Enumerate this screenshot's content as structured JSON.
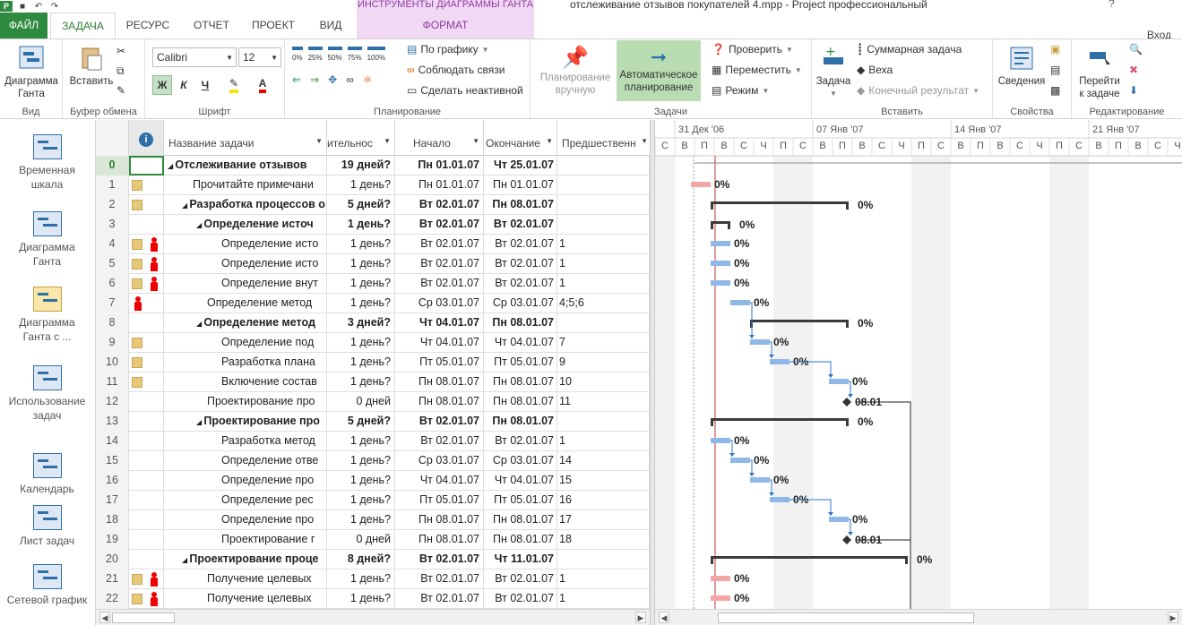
{
  "window": {
    "title": "отслеживание отзывов покупателей 4.mpp - Project профессиональный",
    "context_tab_group": "ИНСТРУМЕНТЫ ДИАГРАММЫ ГАНТА",
    "help": "?",
    "signin": "Вход"
  },
  "tabs": [
    {
      "label": "ФАЙЛ"
    },
    {
      "label": "ЗАДАЧА"
    },
    {
      "label": "РЕСУРС"
    },
    {
      "label": "ОТЧЕТ"
    },
    {
      "label": "ПРОЕКТ"
    },
    {
      "label": "ВИД"
    },
    {
      "label": "ФОРМАТ"
    }
  ],
  "ribbon": {
    "view": {
      "group": "Вид",
      "gantt_btn_line1": "Диаграмма",
      "gantt_btn_line2": "Ганта"
    },
    "clipboard": {
      "group": "Буфер обмена",
      "paste": "Вставить"
    },
    "font": {
      "group": "Шрифт",
      "family": "Calibri",
      "size": "12",
      "bold": "Ж",
      "italic": "К",
      "underline": "Ч"
    },
    "schedule": {
      "group": "Планирование",
      "pcts": [
        "0%",
        "25%",
        "50%",
        "75%",
        "100%"
      ],
      "by_schedule": "По графику",
      "respect_links": "Соблюдать связи",
      "inactivate": "Сделать неактивной"
    },
    "tasks": {
      "group": "Задачи",
      "manual_line1": "Планирование",
      "manual_line2": "вручную",
      "auto_line1": "Автоматическое",
      "auto_line2": "планирование",
      "inspect": "Проверить",
      "move": "Переместить",
      "mode": "Режим"
    },
    "insert": {
      "group": "Вставить",
      "task": "Задача",
      "summary": "Суммарная задача",
      "milestone": "Веха",
      "deliverable": "Конечный результат"
    },
    "properties": {
      "group": "Свойства",
      "info": "Сведения"
    },
    "editing": {
      "group": "Редактирование",
      "goto_line1": "Перейти",
      "goto_line2": "к задаче"
    }
  },
  "viewbar": [
    {
      "line1": "Временная",
      "line2": "шкала"
    },
    {
      "line1": "Диаграмма",
      "line2": "Ганта"
    },
    {
      "line1": "Диаграмма",
      "line2": "Ганта с ...",
      "selected": true
    },
    {
      "line1": "Использование",
      "line2": "задач"
    },
    {
      "line1": "Календарь",
      "line2": ""
    },
    {
      "line1": "Лист задач",
      "line2": ""
    },
    {
      "line1": "Сетевой график",
      "line2": ""
    }
  ],
  "columns": {
    "info": "i",
    "name": "Название задачи",
    "duration": "ительнос",
    "start": "Начало",
    "finish": "Окончание",
    "predecessors": "Предшественн"
  },
  "rows": [
    {
      "id": "0",
      "name": "Отслеживание отзывов",
      "dur": "19 дней?",
      "start": "Пн 01.01.07",
      "finish": "Чт 25.01.07",
      "pred": "",
      "bold": true,
      "level": 0,
      "summary": true,
      "note": false,
      "person": false
    },
    {
      "id": "1",
      "name": "Прочитайте примечани",
      "dur": "1 день?",
      "start": "Пн 01.01.07",
      "finish": "Пн 01.01.07",
      "pred": "",
      "bold": false,
      "level": 1,
      "summary": false,
      "note": true,
      "person": false
    },
    {
      "id": "2",
      "name": "Разработка процессов о",
      "dur": "5 дней?",
      "start": "Вт 02.01.07",
      "finish": "Пн 08.01.07",
      "pred": "",
      "bold": true,
      "level": 1,
      "summary": true,
      "note": true,
      "person": false
    },
    {
      "id": "3",
      "name": "Определение источ",
      "dur": "1 день?",
      "start": "Вт 02.01.07",
      "finish": "Вт 02.01.07",
      "pred": "",
      "bold": true,
      "level": 2,
      "summary": true,
      "note": false,
      "person": false
    },
    {
      "id": "4",
      "name": "Определение исто",
      "dur": "1 день?",
      "start": "Вт 02.01.07",
      "finish": "Вт 02.01.07",
      "pred": "1",
      "bold": false,
      "level": 3,
      "summary": false,
      "note": true,
      "person": true
    },
    {
      "id": "5",
      "name": "Определение исто",
      "dur": "1 день?",
      "start": "Вт 02.01.07",
      "finish": "Вт 02.01.07",
      "pred": "1",
      "bold": false,
      "level": 3,
      "summary": false,
      "note": true,
      "person": true
    },
    {
      "id": "6",
      "name": "Определение внут",
      "dur": "1 день?",
      "start": "Вт 02.01.07",
      "finish": "Вт 02.01.07",
      "pred": "1",
      "bold": false,
      "level": 3,
      "summary": false,
      "note": true,
      "person": true
    },
    {
      "id": "7",
      "name": "Определение метод",
      "dur": "1 день?",
      "start": "Ср 03.01.07",
      "finish": "Ср 03.01.07",
      "pred": "4;5;6",
      "bold": false,
      "level": 2,
      "summary": false,
      "note": false,
      "person": true
    },
    {
      "id": "8",
      "name": "Определение метод",
      "dur": "3 дней?",
      "start": "Чт 04.01.07",
      "finish": "Пн 08.01.07",
      "pred": "",
      "bold": true,
      "level": 2,
      "summary": true,
      "note": false,
      "person": false
    },
    {
      "id": "9",
      "name": "Определение под",
      "dur": "1 день?",
      "start": "Чт 04.01.07",
      "finish": "Чт 04.01.07",
      "pred": "7",
      "bold": false,
      "level": 3,
      "summary": false,
      "note": true,
      "person": false
    },
    {
      "id": "10",
      "name": "Разработка плана",
      "dur": "1 день?",
      "start": "Пт 05.01.07",
      "finish": "Пт 05.01.07",
      "pred": "9",
      "bold": false,
      "level": 3,
      "summary": false,
      "note": true,
      "person": false
    },
    {
      "id": "11",
      "name": "Включение состав",
      "dur": "1 день?",
      "start": "Пн 08.01.07",
      "finish": "Пн 08.01.07",
      "pred": "10",
      "bold": false,
      "level": 3,
      "summary": false,
      "note": true,
      "person": false
    },
    {
      "id": "12",
      "name": "Проектирование про",
      "dur": "0 дней",
      "start": "Пн 08.01.07",
      "finish": "Пн 08.01.07",
      "pred": "11",
      "bold": false,
      "level": 2,
      "summary": false,
      "note": false,
      "person": false
    },
    {
      "id": "13",
      "name": "Проектирование про",
      "dur": "5 дней?",
      "start": "Вт 02.01.07",
      "finish": "Пн 08.01.07",
      "pred": "",
      "bold": true,
      "level": 2,
      "summary": true,
      "note": false,
      "person": false
    },
    {
      "id": "14",
      "name": "Разработка метод",
      "dur": "1 день?",
      "start": "Вт 02.01.07",
      "finish": "Вт 02.01.07",
      "pred": "1",
      "bold": false,
      "level": 3,
      "summary": false,
      "note": false,
      "person": false
    },
    {
      "id": "15",
      "name": "Определение отве",
      "dur": "1 день?",
      "start": "Ср 03.01.07",
      "finish": "Ср 03.01.07",
      "pred": "14",
      "bold": false,
      "level": 3,
      "summary": false,
      "note": false,
      "person": false
    },
    {
      "id": "16",
      "name": "Определение про",
      "dur": "1 день?",
      "start": "Чт 04.01.07",
      "finish": "Чт 04.01.07",
      "pred": "15",
      "bold": false,
      "level": 3,
      "summary": false,
      "note": false,
      "person": false
    },
    {
      "id": "17",
      "name": "Определение рес",
      "dur": "1 день?",
      "start": "Пт 05.01.07",
      "finish": "Пт 05.01.07",
      "pred": "16",
      "bold": false,
      "level": 3,
      "summary": false,
      "note": false,
      "person": false
    },
    {
      "id": "18",
      "name": "Определение про",
      "dur": "1 день?",
      "start": "Пн 08.01.07",
      "finish": "Пн 08.01.07",
      "pred": "17",
      "bold": false,
      "level": 3,
      "summary": false,
      "note": false,
      "person": false
    },
    {
      "id": "19",
      "name": "Проектирование г",
      "dur": "0 дней",
      "start": "Пн 08.01.07",
      "finish": "Пн 08.01.07",
      "pred": "18",
      "bold": false,
      "level": 3,
      "summary": false,
      "note": false,
      "person": false
    },
    {
      "id": "20",
      "name": "Проектирование проце",
      "dur": "8 дней?",
      "start": "Вт 02.01.07",
      "finish": "Чт 11.01.07",
      "pred": "",
      "bold": true,
      "level": 1,
      "summary": true,
      "note": false,
      "person": false
    },
    {
      "id": "21",
      "name": "Получение целевых",
      "dur": "1 день?",
      "start": "Вт 02.01.07",
      "finish": "Вт 02.01.07",
      "pred": "1",
      "bold": false,
      "level": 2,
      "summary": false,
      "note": true,
      "person": true
    },
    {
      "id": "22",
      "name": "Получение целевых",
      "dur": "1 день?",
      "start": "Вт 02.01.07",
      "finish": "Вт 02.01.07",
      "pred": "1",
      "bold": false,
      "level": 2,
      "summary": false,
      "note": true,
      "person": true
    }
  ],
  "timescale": {
    "weeks": [
      "31 Дек '06",
      "07 Янв '07",
      "14 Янв '07",
      "21 Янв '07"
    ],
    "days": [
      "С",
      "В",
      "П",
      "В",
      "С",
      "Ч",
      "П",
      "С",
      "В",
      "П",
      "В",
      "С",
      "Ч",
      "П",
      "С",
      "В",
      "П",
      "В",
      "С",
      "Ч",
      "П",
      "С",
      "В",
      "П",
      "В",
      "С",
      "Ч"
    ]
  },
  "gantt_bars": [
    {
      "row": 0,
      "type": "project",
      "start": 0,
      "end": 27,
      "label": ""
    },
    {
      "row": 1,
      "type": "critical",
      "start": 0,
      "end": 1,
      "label": "0%"
    },
    {
      "row": 2,
      "type": "summary",
      "start": 1,
      "end": 8,
      "label": "0%"
    },
    {
      "row": 3,
      "type": "summary",
      "start": 1,
      "end": 2,
      "label": "0%"
    },
    {
      "row": 4,
      "type": "task",
      "start": 1,
      "end": 2,
      "label": "0%"
    },
    {
      "row": 5,
      "type": "task",
      "start": 1,
      "end": 2,
      "label": "0%"
    },
    {
      "row": 6,
      "type": "task",
      "start": 1,
      "end": 2,
      "label": "0%"
    },
    {
      "row": 7,
      "type": "task",
      "start": 2,
      "end": 3,
      "label": "0%"
    },
    {
      "row": 8,
      "type": "summary",
      "start": 3,
      "end": 8,
      "label": "0%"
    },
    {
      "row": 9,
      "type": "task",
      "start": 3,
      "end": 4,
      "label": "0%"
    },
    {
      "row": 10,
      "type": "task",
      "start": 4,
      "end": 5,
      "label": "0%"
    },
    {
      "row": 11,
      "type": "task",
      "start": 7,
      "end": 8,
      "label": "0%"
    },
    {
      "row": 12,
      "type": "milestone",
      "start": 8,
      "end": 8,
      "label": "08.01"
    },
    {
      "row": 13,
      "type": "summary",
      "start": 1,
      "end": 8,
      "label": "0%"
    },
    {
      "row": 14,
      "type": "task",
      "start": 1,
      "end": 2,
      "label": "0%"
    },
    {
      "row": 15,
      "type": "task",
      "start": 2,
      "end": 3,
      "label": "0%"
    },
    {
      "row": 16,
      "type": "task",
      "start": 3,
      "end": 4,
      "label": "0%"
    },
    {
      "row": 17,
      "type": "task",
      "start": 4,
      "end": 5,
      "label": "0%"
    },
    {
      "row": 18,
      "type": "task",
      "start": 7,
      "end": 8,
      "label": "0%"
    },
    {
      "row": 19,
      "type": "milestone",
      "start": 8,
      "end": 8,
      "label": "08.01"
    },
    {
      "row": 20,
      "type": "summary",
      "start": 1,
      "end": 11,
      "label": "0%"
    },
    {
      "row": 21,
      "type": "critical",
      "start": 1,
      "end": 2,
      "label": "0%"
    },
    {
      "row": 22,
      "type": "critical",
      "start": 1,
      "end": 2,
      "label": "0%"
    }
  ],
  "colors": {
    "file_tab": "#2e8a3e",
    "context": "#f1d9f6",
    "task_bar": "#8fb8e6",
    "critical_bar": "#f4a6a6",
    "summary_bar": "#3b3b3b",
    "link": "#2f75c4",
    "today": "#c0392b",
    "weekend": "#f2f2f2"
  }
}
